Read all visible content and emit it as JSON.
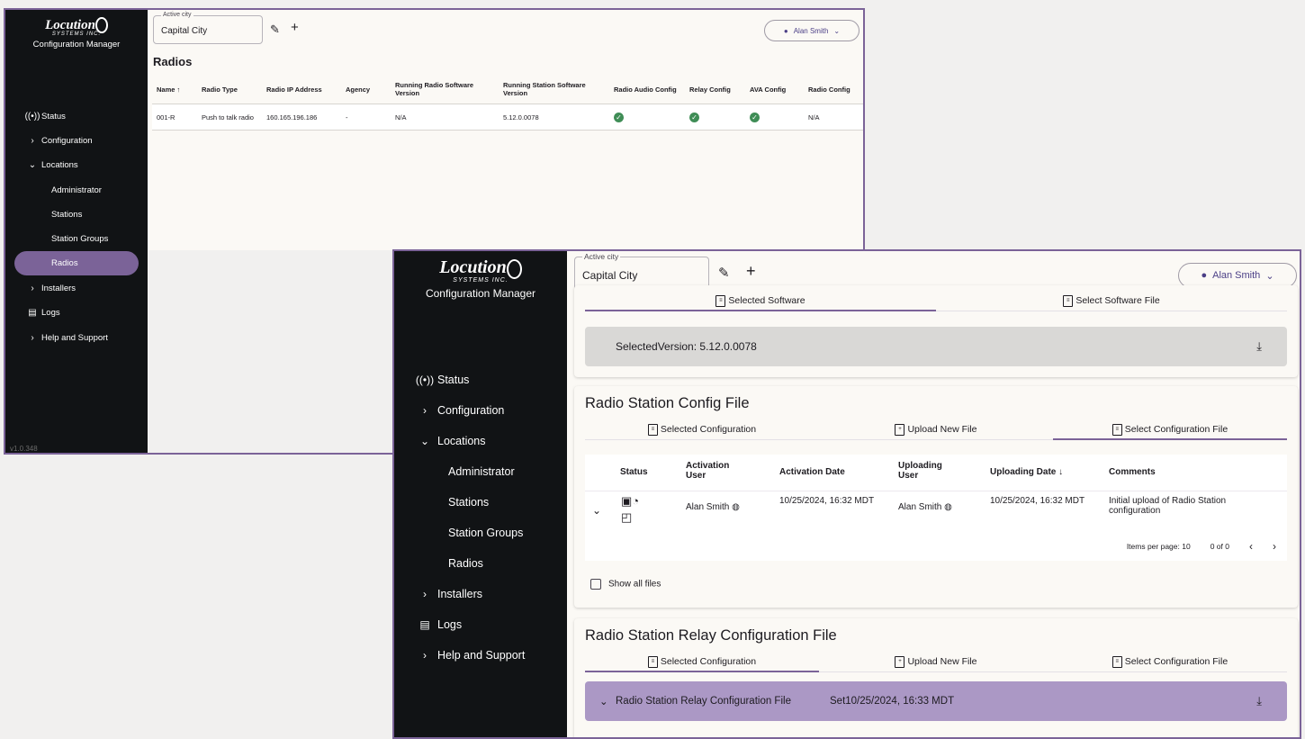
{
  "app": {
    "brand": "Locution",
    "brand_sub": "SYSTEMS INC.",
    "subtitle": "Configuration Manager",
    "version": "v1.0.348"
  },
  "nav": [
    {
      "label": "Status",
      "icon": "broadcast-icon"
    },
    {
      "label": "Configuration",
      "icon": "chevron-right-icon"
    },
    {
      "label": "Locations",
      "icon": "chevron-down-icon"
    },
    {
      "label": "Administrator"
    },
    {
      "label": "Stations"
    },
    {
      "label": "Station Groups"
    },
    {
      "label": "Radios"
    },
    {
      "label": "Installers",
      "icon": "chevron-right-icon"
    },
    {
      "label": "Logs",
      "icon": "logs-icon"
    },
    {
      "label": "Help and Support",
      "icon": "chevron-right-icon"
    }
  ],
  "topbar": {
    "city_label": "Active city",
    "city_value": "Capital City",
    "user": "Alan Smith"
  },
  "radios_page": {
    "title": "Radios",
    "columns": [
      "Name ↑",
      "Radio Type",
      "Radio IP Address",
      "Agency",
      "Running Radio Software Version",
      "Running Station Software Version",
      "Radio Audio Config",
      "Relay Config",
      "AVA Config",
      "Radio Config"
    ],
    "row": {
      "name": "001-R",
      "type": "Push to talk radio",
      "ip": "160.165.196.186",
      "agency": "-",
      "radio_sw": "N/A",
      "station_sw": "5.12.0.0078",
      "radio_config": "N/A"
    }
  },
  "software": {
    "tab_selected": "Selected Software",
    "tab_select_file": "Select Software File",
    "selected_version": "SelectedVersion: 5.12.0.0078"
  },
  "config_file": {
    "title": "Radio Station Config File",
    "tabs": [
      "Selected Configuration",
      "Upload New File",
      "Select Configuration File"
    ],
    "columns": [
      "Status",
      "Activation User",
      "Activation Date",
      "Uploading User",
      "Uploading Date ↓",
      "Comments"
    ],
    "row": {
      "activation_user": "Alan Smith",
      "activation_date": "10/25/2024, 16:32 MDT",
      "uploading_user": "Alan Smith",
      "uploading_date": "10/25/2024, 16:32 MDT",
      "comments": "Initial upload of Radio Station configuration"
    },
    "pager": {
      "label": "Items per page:",
      "size": "10",
      "range": "0 of 0"
    },
    "show_all": "Show all files"
  },
  "relay_file": {
    "title": "Radio Station Relay Configuration File",
    "tabs": [
      "Selected Configuration",
      "Upload New File",
      "Select Configuration File"
    ],
    "bar_label": "Radio Station Relay Configuration File",
    "bar_set": "Set10/25/2024, 16:33 MDT"
  },
  "colors": {
    "accent": "#7b6398",
    "sidebar": "#111315",
    "ok": "#3f8d56"
  }
}
